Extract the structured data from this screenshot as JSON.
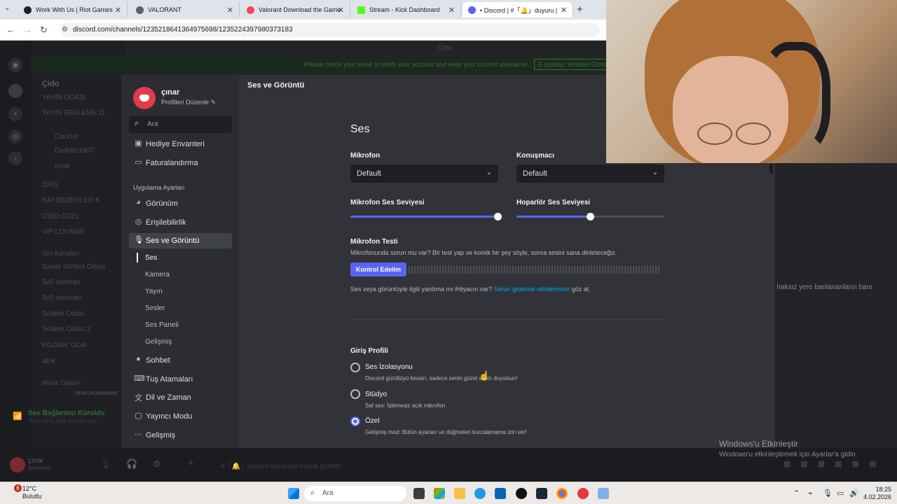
{
  "browser": {
    "tabs": [
      {
        "title": "Work With Us | Riot Games",
        "color": "#202124"
      },
      {
        "title": "VALORANT",
        "color": "#5f6368"
      },
      {
        "title": "Valorant Download the Game",
        "color": "#fa4454"
      },
      {
        "title": "Stream - Kick Dashboard",
        "color": "#53fc18"
      },
      {
        "title": "• Discord | #「🔔」duyuru | Ç",
        "color": "#5865f2"
      }
    ],
    "url": "discord.com/channels/1235218641364975698/1235224397980373183"
  },
  "discord_bg": {
    "server_name": "Çido",
    "topbar_title": "Çido",
    "notice": "Please check your email to verify your account and keep your current username.",
    "notice_button": "E-postayı Yeniden Gönd",
    "channels": [
      "YAYIN ODASI",
      "YAYIN BEKLEME O",
      "Cla  lost",
      "Darklite1907",
      "çınar",
      "OFİS",
      "KAYBEDENLER K",
      "CİDO ÖZEL",
      "VIP LOUNGE",
      "Ses Kanalları",
      "Genel Sohbet Odası",
      "5v5 saldıran",
      "5v5 savunan",
      "Sohbet Odası",
      "Sohbet Odası 2",
      "KOZMİK ODA",
      "AFK",
      "Müzik Odaları",
      "YENİ OKUNMAMIŞ"
    ],
    "voice_status": "Ses Bağlantısı Kuruldu",
    "voice_channel": "YAYIN BEKLEME ODASI / Çido",
    "user_name": "çınar",
    "user_status": "Görünmez",
    "message_placeholder": "#「🔔」duyuru kanalına mesaj gönder",
    "right_text": "o haksız yere banlananların banı"
  },
  "settings": {
    "header_title": "Ses ve Görüntü",
    "profile_name": "çınar",
    "profile_edit": "Profilleri Düzenle ✎",
    "search_placeholder": "Ara",
    "items_top": [
      "Hediye Envanteri",
      "Faturalandırma"
    ],
    "group_label": "Uygulama Ayarları",
    "items_app": [
      "Görünüm",
      "Erişilebilirlik",
      "Ses ve Görüntü"
    ],
    "subitems": [
      "Ses",
      "Kamera",
      "Yayın",
      "Sesler",
      "Ses Paneli",
      "Gelişmiş"
    ],
    "items_bottom": [
      "Sohbet",
      "Tuş Atamaları",
      "Dil ve Zaman",
      "Yayıncı Modu",
      "Gelişmiş"
    ],
    "section_title": "Ses",
    "mic_label": "Mikrofon",
    "mic_value": "Default",
    "speaker_label": "Konuşmacı",
    "speaker_value": "Default",
    "mic_volume_label": "Mikrofon Ses Seviyesi",
    "mic_volume_fraction": 1.0,
    "speaker_volume_label": "Hoparlör Ses Seviyesi",
    "speaker_volume_fraction": 0.5,
    "mic_test_title": "Mikrofon Testi",
    "mic_test_desc": "Mikrofonunda sorun mu var? Bir test yap ve komik bir şey söyle, sonra sesini sana dinleteceğiz.",
    "mic_test_button": "Kontrol Edelim",
    "help_prefix": "Ses veya görüntüyle ilgili yardıma mı ihtiyacın var?",
    "help_link": "Sorun giderme rehberimize",
    "help_suffix": "göz at.",
    "input_profile_title": "Giriş Profili",
    "profiles": [
      {
        "title": "Ses İzolasyonu",
        "desc": "Discord gürültüyü kessin, sadece senin güzel sesin duyulsun!",
        "selected": false
      },
      {
        "title": "Stüdyo",
        "desc": "Saf ses: İşlemesiz açık mikrofon",
        "selected": false
      },
      {
        "title": "Özel",
        "desc": "Gelişmiş mod: Bütün ayarları ve düğmeleri kurcalamama izin ver!",
        "selected": true
      }
    ]
  },
  "windows_activation": {
    "title": "Windows'u Etkinleştir",
    "subtitle": "Windows'u etkinleştirmek için Ayarlar'a gidin."
  },
  "taskbar": {
    "weather_temp": "12°C",
    "weather_desc": "Bulutlu",
    "weather_badge": "6",
    "search_placeholder": "Ara",
    "time": "18:25",
    "date": "4.02.2026"
  }
}
